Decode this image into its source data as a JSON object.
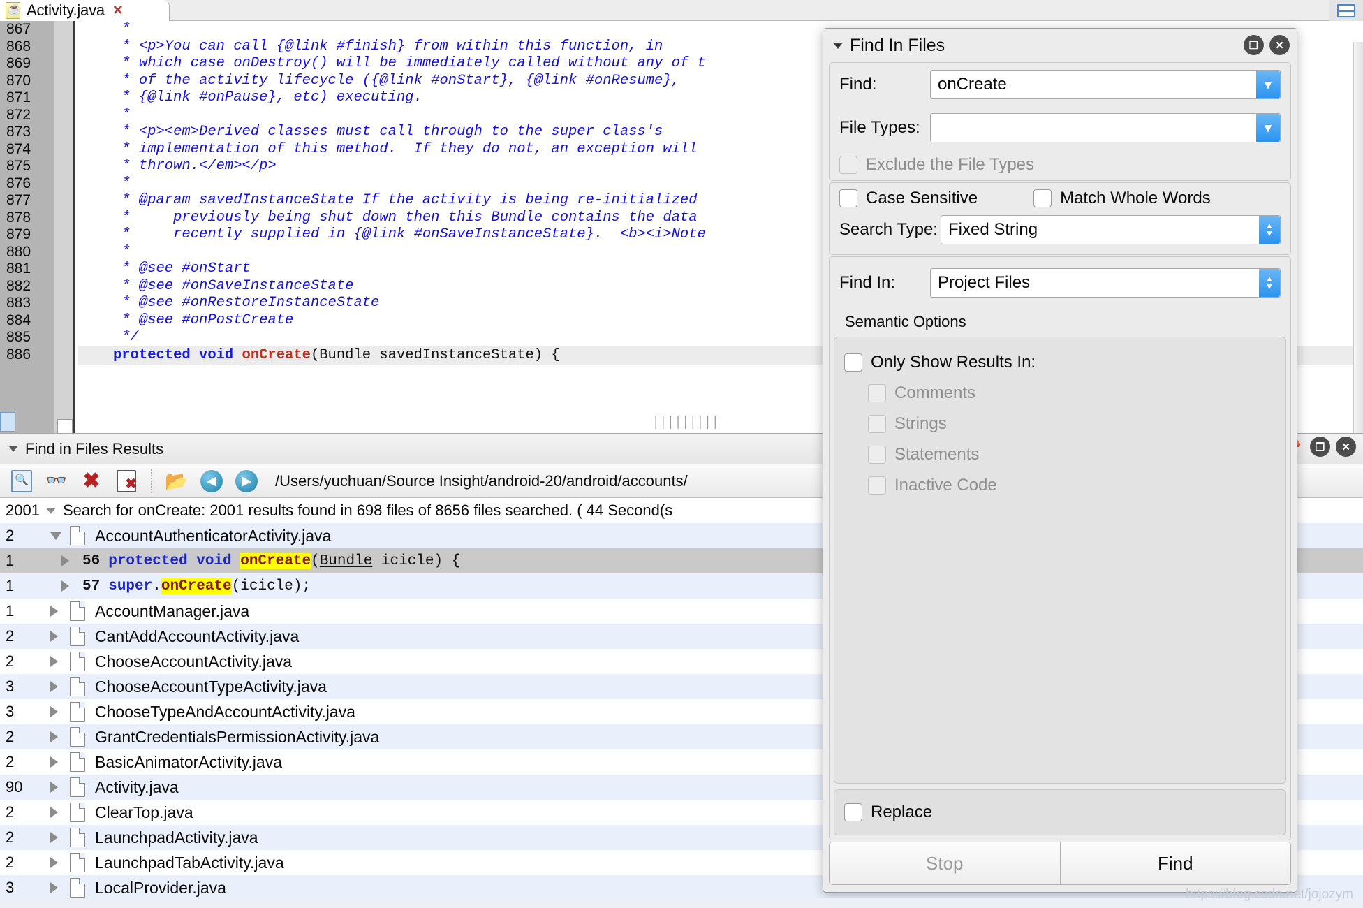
{
  "tab": {
    "label": "Activity.java",
    "close_glyph": "✕",
    "icon": "java-file-icon"
  },
  "editor": {
    "lines": [
      {
        "num": "867",
        "text": " *"
      },
      {
        "num": "868",
        "text": " * <p>You can call {@link #finish} from within this function, in"
      },
      {
        "num": "869",
        "text": " * which case onDestroy() will be immediately called without any of t"
      },
      {
        "num": "870",
        "text": " * of the activity lifecycle ({@link #onStart}, {@link #onResume},"
      },
      {
        "num": "871",
        "text": " * {@link #onPause}, etc) executing."
      },
      {
        "num": "872",
        "text": " *"
      },
      {
        "num": "873",
        "text": " * <p><em>Derived classes must call through to the super class's"
      },
      {
        "num": "874",
        "text": " * implementation of this method.  If they do not, an exception will"
      },
      {
        "num": "875",
        "text": " * thrown.</em></p>"
      },
      {
        "num": "876",
        "text": " *"
      },
      {
        "num": "877",
        "text": " * @param savedInstanceState If the activity is being re-initialized"
      },
      {
        "num": "878",
        "text": " *     previously being shut down then this Bundle contains the data"
      },
      {
        "num": "879",
        "text": " *     recently supplied in {@link #onSaveInstanceState}.  <b><i>Note"
      },
      {
        "num": "880",
        "text": " *"
      },
      {
        "num": "881",
        "text": " * @see #onStart"
      },
      {
        "num": "882",
        "text": " * @see #onSaveInstanceState"
      },
      {
        "num": "883",
        "text": " * @see #onRestoreInstanceState"
      },
      {
        "num": "884",
        "text": " * @see #onPostCreate"
      },
      {
        "num": "885",
        "text": " */"
      }
    ],
    "last_line": {
      "num": "886",
      "kw1": "protected void ",
      "method": "onCreate",
      "rest": "(Bundle savedInstanceState) {"
    },
    "dotted_tail": "▕▕▕▕▕▕▕▕▕"
  },
  "results": {
    "title": "Find in Files Results",
    "toolbar": {
      "icons": [
        "search-in-results-icon",
        "binoculars-icon",
        "clear-icon",
        "clear-all-icon",
        "open-folder-icon",
        "back-arrow-icon",
        "forward-arrow-icon"
      ],
      "path": "/Users/yuchuan/Source Insight/android-20/android/accounts/"
    },
    "summary": {
      "count": "2001",
      "text": "Search for onCreate: 2001 results found in 698 files of 8656 files searched. ( 44 Second(s"
    },
    "rows": [
      {
        "type": "file",
        "count": "2",
        "name": "AccountAuthenticatorActivity.java",
        "expanded": true,
        "stripe": "alt"
      },
      {
        "type": "match",
        "count": "1",
        "line": "56",
        "kw": "protected void ",
        "hit": "onCreate",
        "type_word": "Bundle",
        "tail": " icicle) {",
        "prefix": "",
        "stripe": "sel"
      },
      {
        "type": "match",
        "count": "1",
        "line": "57",
        "kw": "super",
        "dot": ".",
        "hit": "onCreate",
        "tail": "(icicle);",
        "stripe": "alt"
      },
      {
        "type": "file",
        "count": "1",
        "name": "AccountManager.java",
        "expanded": false,
        "stripe": "white"
      },
      {
        "type": "file",
        "count": "2",
        "name": "CantAddAccountActivity.java",
        "expanded": false,
        "stripe": "alt"
      },
      {
        "type": "file",
        "count": "2",
        "name": "ChooseAccountActivity.java",
        "expanded": false,
        "stripe": "white"
      },
      {
        "type": "file",
        "count": "3",
        "name": "ChooseAccountTypeActivity.java",
        "expanded": false,
        "stripe": "alt"
      },
      {
        "type": "file",
        "count": "3",
        "name": "ChooseTypeAndAccountActivity.java",
        "expanded": false,
        "stripe": "white"
      },
      {
        "type": "file",
        "count": "2",
        "name": "GrantCredentialsPermissionActivity.java",
        "expanded": false,
        "stripe": "alt"
      },
      {
        "type": "file",
        "count": "2",
        "name": "BasicAnimatorActivity.java",
        "expanded": false,
        "stripe": "white"
      },
      {
        "type": "file",
        "count": "90",
        "name": "Activity.java",
        "expanded": false,
        "stripe": "alt"
      },
      {
        "type": "file",
        "count": "2",
        "name": "ClearTop.java",
        "expanded": false,
        "stripe": "white"
      },
      {
        "type": "file",
        "count": "2",
        "name": "LaunchpadActivity.java",
        "expanded": false,
        "stripe": "alt"
      },
      {
        "type": "file",
        "count": "2",
        "name": "LaunchpadTabActivity.java",
        "expanded": false,
        "stripe": "white"
      },
      {
        "type": "file",
        "count": "3",
        "name": "LocalProvider.java",
        "expanded": false,
        "stripe": "alt"
      }
    ]
  },
  "dialog": {
    "title": "Find In Files",
    "restore_glyph": "❐",
    "close_glyph": "✕",
    "find_label": "Find:",
    "find_value": "onCreate",
    "file_types_label": "File Types:",
    "file_types_value": "",
    "exclude_label": "Exclude the File Types",
    "case_sensitive_label": "Case Sensitive",
    "match_whole_words_label": "Match Whole Words",
    "search_type_label": "Search Type:",
    "search_type_value": "Fixed String",
    "find_in_label": "Find In:",
    "find_in_value": "Project Files",
    "semantic_options_label": "Semantic Options",
    "only_show_results_label": "Only Show Results In:",
    "sub_options": [
      "Comments",
      "Strings",
      "Statements",
      "Inactive Code"
    ],
    "replace_label": "Replace",
    "stop_label": "Stop",
    "find_button_label": "Find"
  },
  "watermark": "https://blog.csdn.net/jojozym",
  "colors": {
    "comment_blue": "#1411e8",
    "highlight_yellow": "#ffff00",
    "selection_gray": "#c9c9c9",
    "row_alt_blue": "#eaf0fb",
    "accent_blue": "#2b93ee"
  }
}
